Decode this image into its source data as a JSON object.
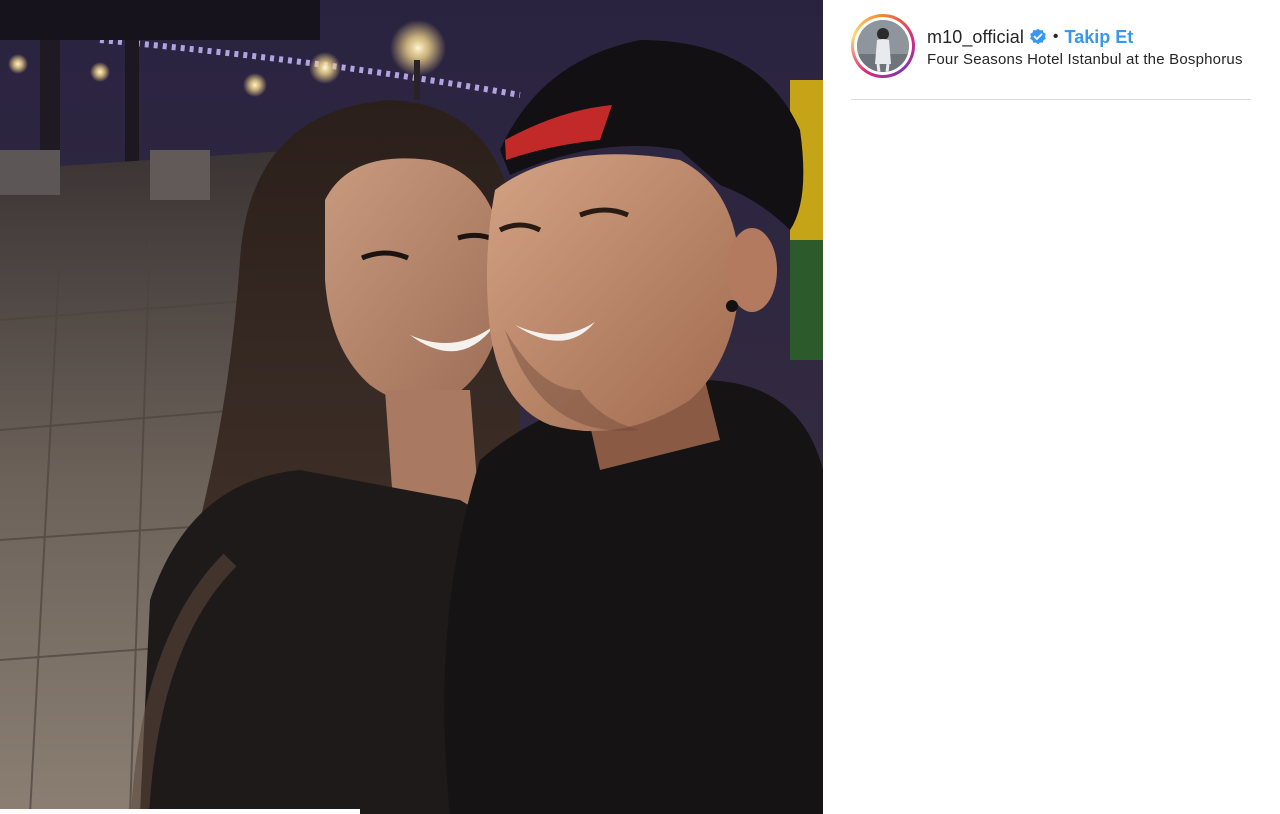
{
  "post": {
    "username": "m10_official",
    "verified": true,
    "separator": "•",
    "follow_label": "Takip Et",
    "location": "Four Seasons Hotel Istanbul at the Bosphorus"
  },
  "colors": {
    "follow": "#3897f0",
    "verified_badge": "#3897f0",
    "divider": "#dbdbdb"
  },
  "icons": {
    "verified": "verified-badge-icon"
  }
}
